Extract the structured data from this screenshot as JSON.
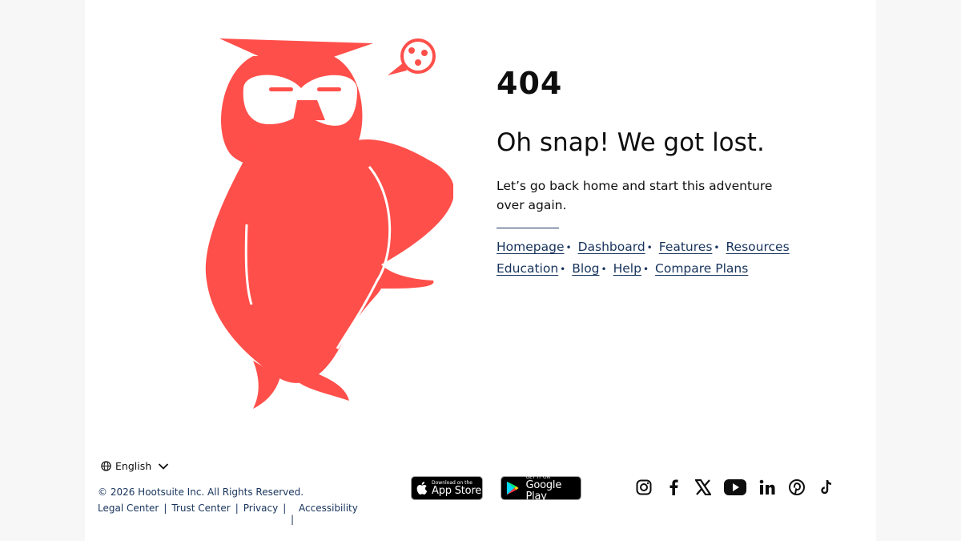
{
  "error": {
    "code": "404",
    "heading": "Oh snap! We got lost.",
    "description": "Let’s go back home and start this adventure over again."
  },
  "links": {
    "row1": [
      "Homepage",
      "Dashboard",
      "Features",
      "Resources"
    ],
    "row2": [
      "Education",
      "Blog",
      "Help",
      "Compare Plans"
    ]
  },
  "footer": {
    "language": "English",
    "copyright": "©  2026 Hootsuite Inc. All Rights Reserved.",
    "legal": [
      "Legal Center",
      "Trust Center",
      "Privacy",
      "Accessibility"
    ],
    "app_store": {
      "small": "Download on the",
      "big": "App Store"
    },
    "google_play": {
      "small": "GET IT ON",
      "big": "Google Play"
    },
    "socials": [
      "instagram-icon",
      "facebook-icon",
      "x-icon",
      "youtube-icon",
      "linkedin-icon",
      "pinterest-icon",
      "tiktok-icon"
    ]
  },
  "colors": {
    "owl": "#ff4f4a",
    "link": "#17335c"
  }
}
